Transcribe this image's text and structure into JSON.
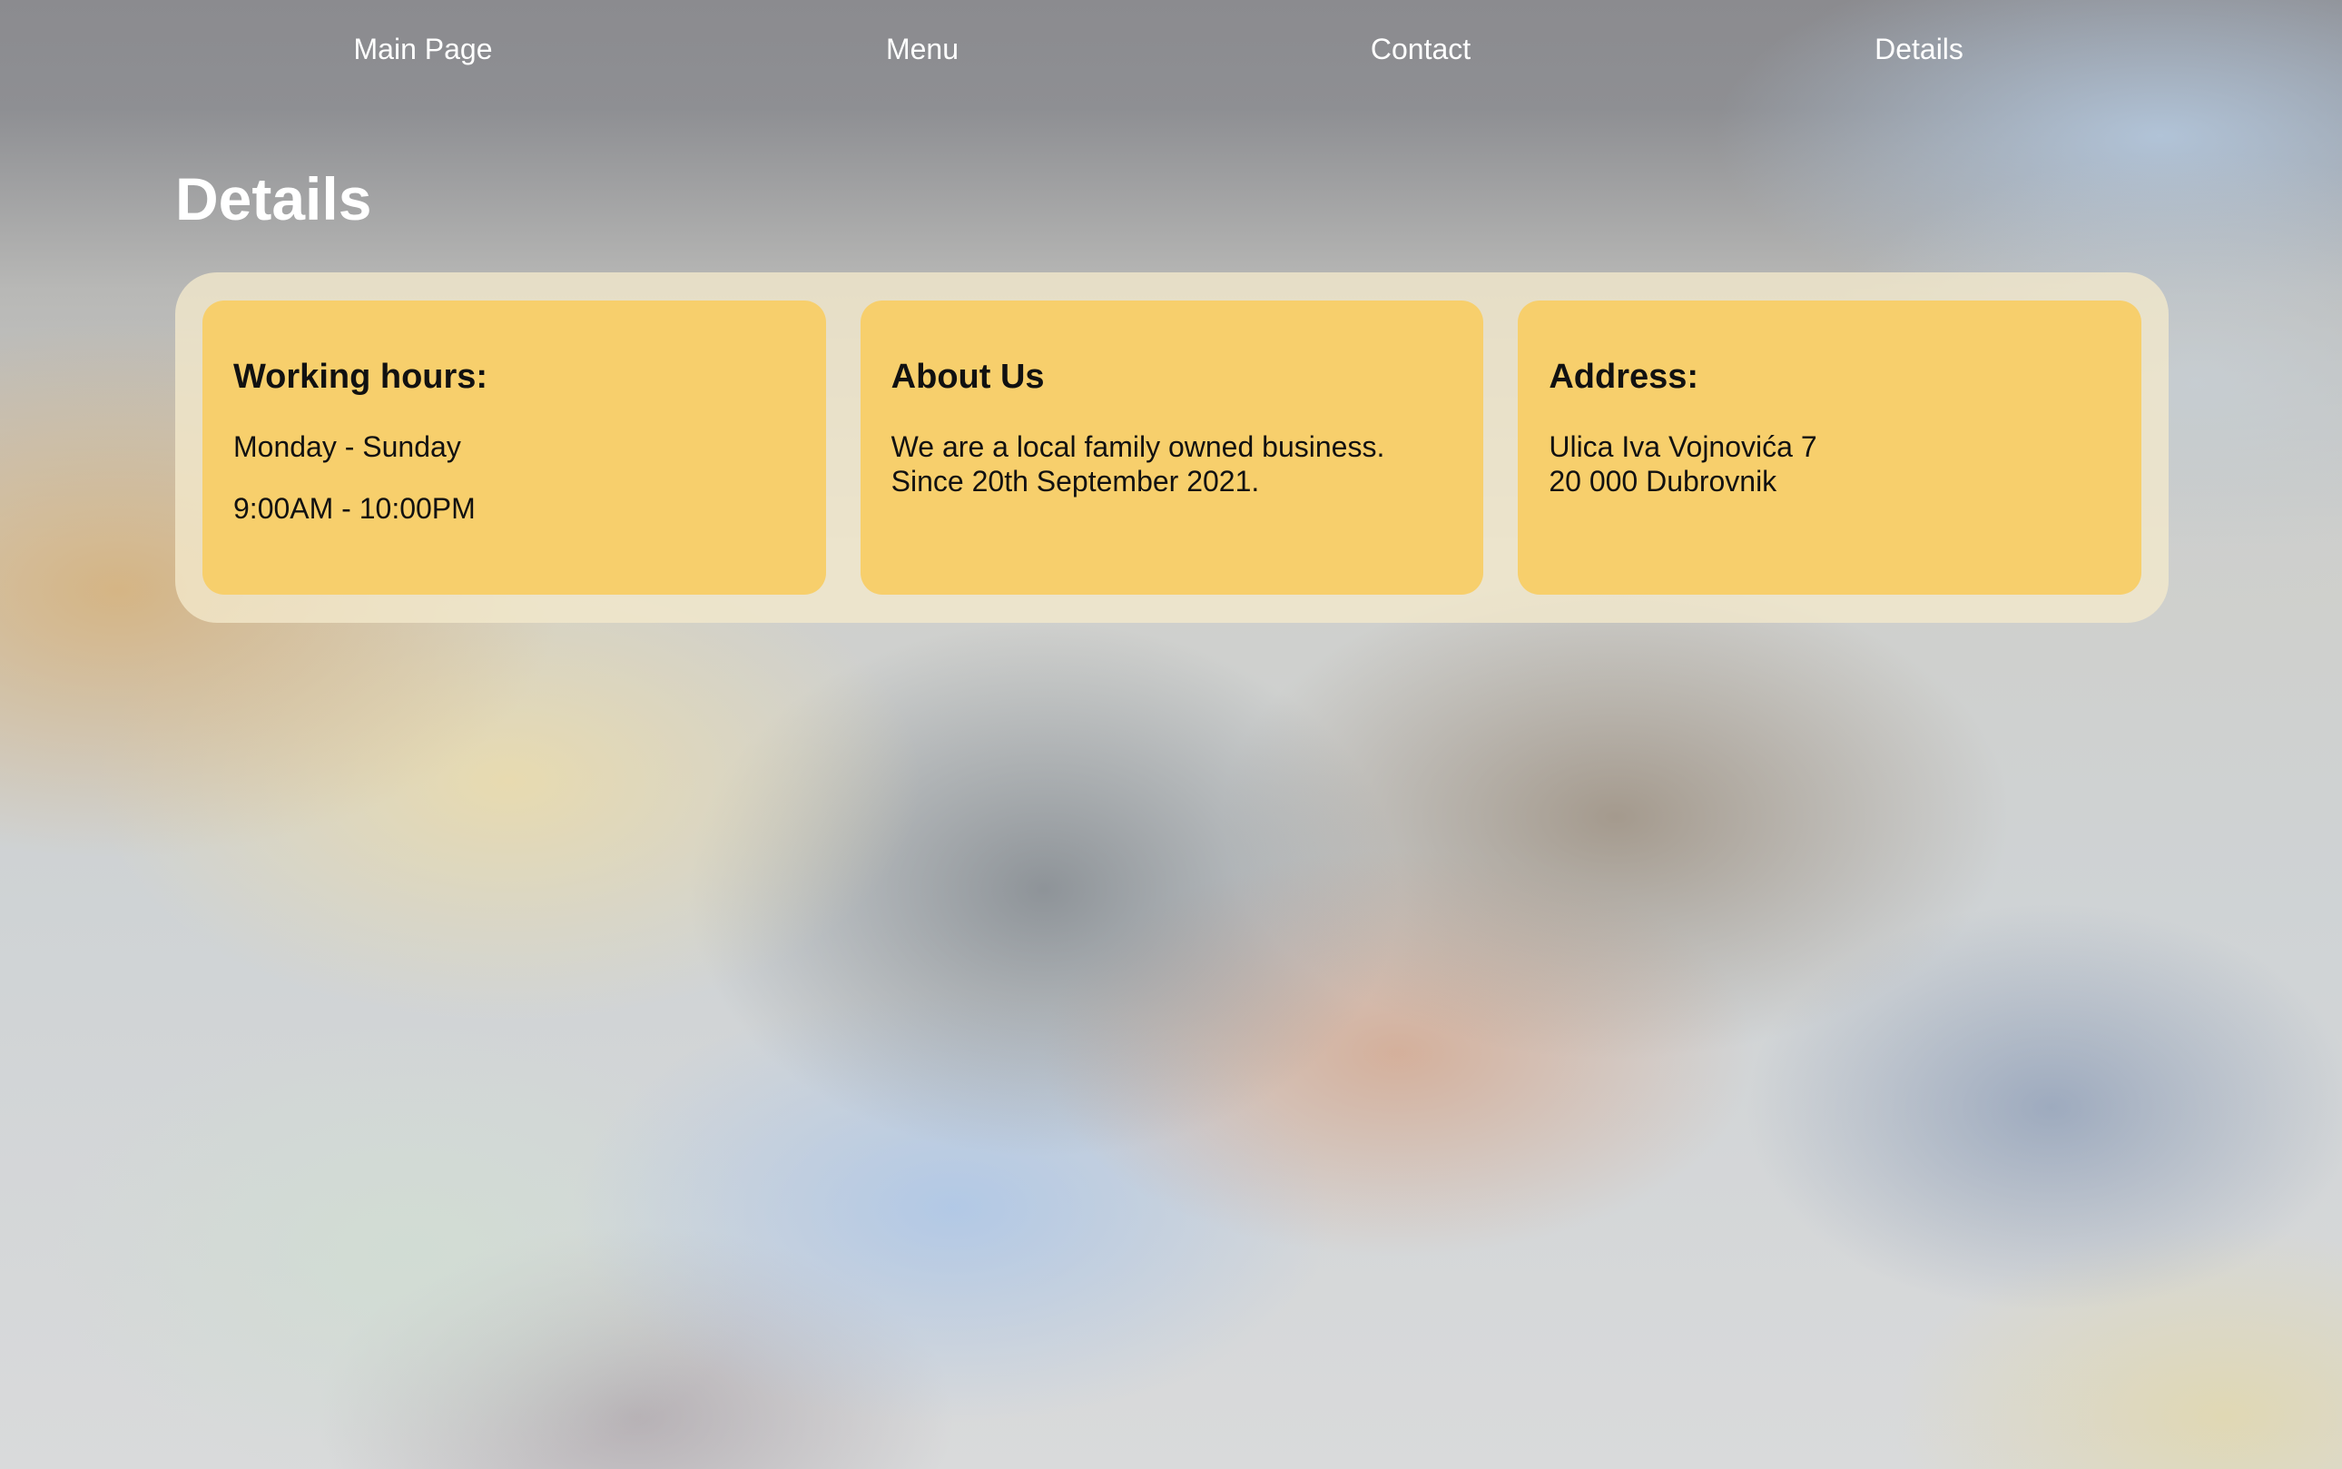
{
  "nav": {
    "items": [
      {
        "label": "Main Page"
      },
      {
        "label": "Menu"
      },
      {
        "label": "Contact"
      },
      {
        "label": "Details"
      }
    ]
  },
  "main": {
    "title": "Details",
    "cards": [
      {
        "heading": "Working hours:",
        "lines": [
          "Monday - Sunday",
          "9:00AM - 10:00PM"
        ]
      },
      {
        "heading": "About Us",
        "lines": [
          "We are a local family owned business.",
          "Since 20th September 2021."
        ]
      },
      {
        "heading": "Address:",
        "lines": [
          "Ulica Iva Vojnovića 7",
          "20 000 Dubrovnik"
        ]
      }
    ]
  },
  "colors": {
    "card_background": "#f7cf6c",
    "panel_background": "#f3e9cc",
    "nav_text": "#ffffff",
    "title_text": "#ffffff"
  }
}
